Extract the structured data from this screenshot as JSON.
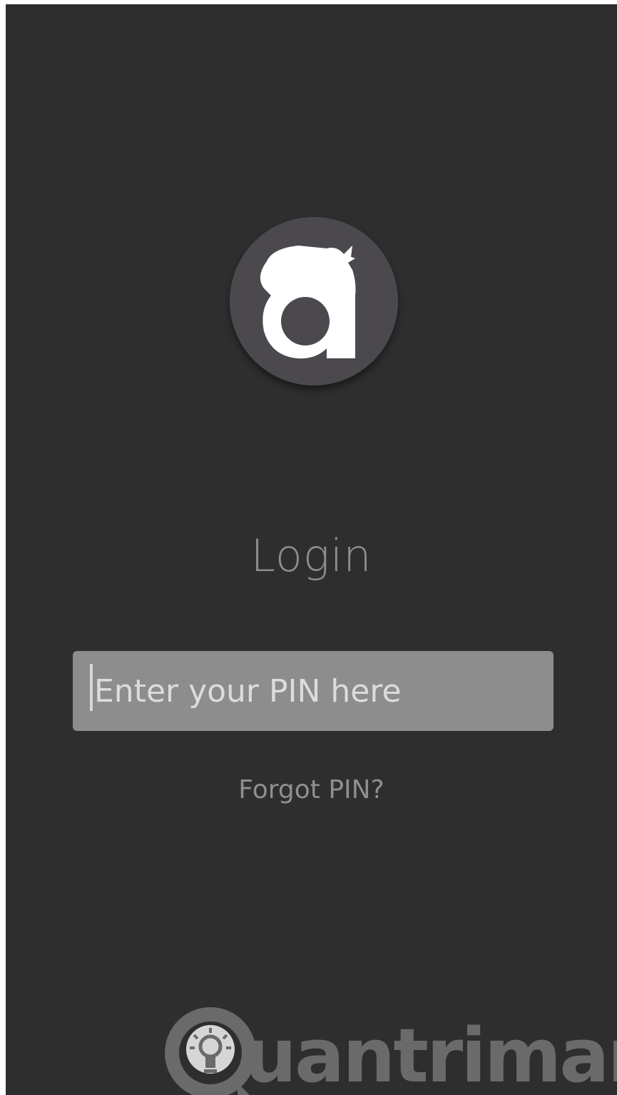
{
  "login": {
    "title": "Login",
    "pin_placeholder": "Enter your PIN here",
    "pin_value": "",
    "forgot_label": "Forgot PIN?"
  },
  "logo": {
    "icon": "app-logo-a-icon",
    "circle_color": "#4b494e",
    "mark_color": "#ffffff"
  },
  "watermark": {
    "text": "uantrimang",
    "icon": "lightbulb-icon"
  },
  "colors": {
    "background": "#2e2e2e",
    "input_background": "#8d8d8d",
    "text_muted": "#8e8e8e"
  }
}
